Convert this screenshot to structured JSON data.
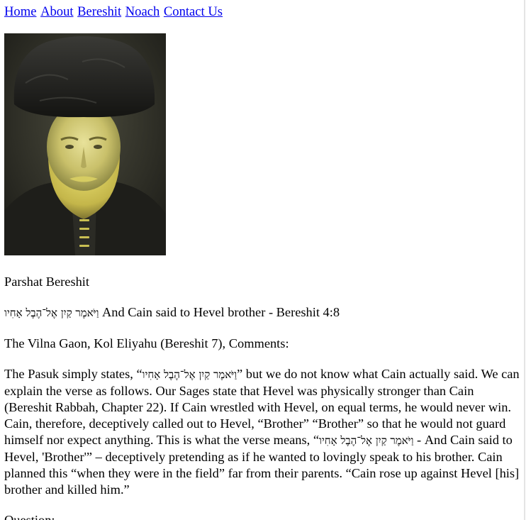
{
  "nav": {
    "items": [
      {
        "label": "Home"
      },
      {
        "label": "About"
      },
      {
        "label": "Bereshit"
      },
      {
        "label": "Noach"
      },
      {
        "label": "Contact Us"
      }
    ],
    "link_color": "#0000ee"
  },
  "portrait": {
    "icon": "portrait-photo"
  },
  "content": {
    "parsha_title": "Parshat Bereshit",
    "verse_hebrew": "וַיֹּאמֶר קַיִן אֶל־הֶבֶל אָחִיו",
    "verse_english": " And Cain said to Hevel brother - Bereshit 4:8",
    "source_line": "The Vilna Gaon, Kol Eliyahu (Bereshit 7), Comments:",
    "body_1": "The Pasuk simply states, “",
    "body_1_hebrew": "וַיֹּאמֶר קַיִן אֶל־הֶבֶל אָחִיו",
    "body_2": "” but we do not know what Cain actually said. We can explain the verse as follows. Our Sages state that Hevel was physically stronger than Cain (Bereshit Rabbah, Chapter 22). If Cain wrestled with Hevel, on equal terms, he would never win. Cain, therefore, deceptively called out to Hevel, “Brother” “Brother” so that he would not guard himself nor expect anything. This is what the verse means, “",
    "body_2_hebrew": "וַיֹּאמֶר קַיִן אֶל־הֶבֶל אָחִיו",
    "body_3": " - And Cain said to Hevel, 'Brother'” – deceptively pretending as if he wanted to lovingly speak to his brother. Cain planned this “when they were in the field” far from their parents. “Cain rose up against Hevel [his] brother and killed him.”",
    "question_label": "Question:"
  }
}
